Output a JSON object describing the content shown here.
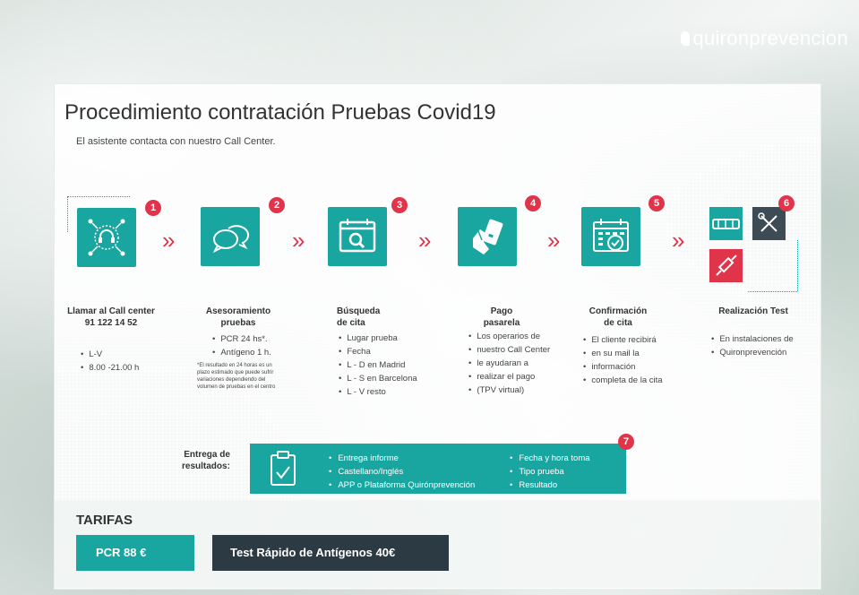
{
  "brand": {
    "name": "quironprevencion"
  },
  "title": "Procedimiento contratación Pruebas Covid19",
  "subtitle": "El asistente contacta con nuestro Call Center.",
  "steps": [
    {
      "num": "1",
      "title": "Llamar al Call center",
      "title2": "91 122 14 52",
      "bullets": [
        "L-V",
        "8.00 -21.00 h"
      ],
      "icon": "headset-network-icon"
    },
    {
      "num": "2",
      "title": "Asesoramiento",
      "title2": "pruebas",
      "bullets": [
        "PCR 24 hs*.",
        "Antígeno 1 h."
      ],
      "note": "*El resultado en 24 horas es un plazo estimado que puede sufrir variaciones dependiendo del volumen de pruebas en el centro",
      "icon": "chat-bubbles-icon"
    },
    {
      "num": "3",
      "title": "Búsqueda",
      "title2": "de cita",
      "bullets": [
        "Lugar prueba",
        "Fecha",
        "L - D en Madrid",
        "L - S en Barcelona",
        "L - V resto"
      ],
      "icon": "calendar-search-icon"
    },
    {
      "num": "4",
      "title": "Pago",
      "title2": "pasarela",
      "bullets": [
        "Los operarios de",
        "nuestro Call Center",
        "le ayudaran a",
        "realizar el pago",
        "(TPV virtual)"
      ],
      "icon": "card-payment-icon"
    },
    {
      "num": "5",
      "title": "Confirmación",
      "title2": "de cita",
      "bullets": [
        "El cliente recibirá",
        "en su mail la",
        "información",
        "completa de la cita"
      ],
      "icon": "calendar-check-icon"
    },
    {
      "num": "6",
      "title": "Realización Test",
      "title2": "",
      "bullets": [
        "En instalaciones de",
        "Quironprevención"
      ],
      "icon": "test-tools-icon"
    }
  ],
  "delivery": {
    "num": "7",
    "label1": "Entrega de",
    "label2": "resultados:",
    "col1": [
      "Entrega informe",
      "Castellano/Inglés",
      "APP o Plataforma Quirónprevención"
    ],
    "col2": [
      "Fecha y hora toma",
      "Tipo prueba",
      "Resultado"
    ]
  },
  "tarifas": {
    "heading": "TARIFAS",
    "pcr": "PCR 88 €",
    "antigenos": "Test Rápido de Antígenos 40€"
  },
  "colors": {
    "teal": "#1aa6a0",
    "red": "#e0344b",
    "dark": "#2c3a43"
  }
}
